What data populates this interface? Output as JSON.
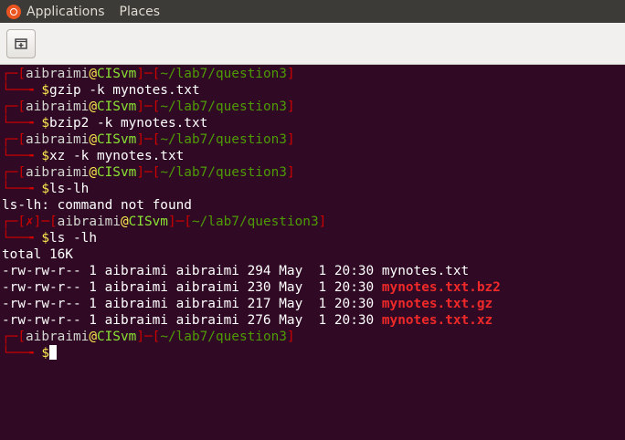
{
  "panel": {
    "menu": [
      "Applications",
      "Places"
    ]
  },
  "toolbar": {
    "new_tab_icon": "new-tab-icon"
  },
  "prompt": {
    "user": "aibraimi",
    "at": "@",
    "host": "CISvm",
    "path": "~/lab7/question3",
    "symbol": "$",
    "error_mark": "✗"
  },
  "commands": [
    "gzip -k mynotes.txt",
    "bzip2 -k mynotes.txt",
    "xz -k mynotes.txt",
    "ls-lh",
    "ls -lh"
  ],
  "error_output": "ls-lh: command not found",
  "ls_total": "total 16K",
  "ls_rows": [
    {
      "perms": "-rw-rw-r--",
      "links": "1",
      "owner": "aibraimi",
      "group": "aibraimi",
      "size": "294",
      "date": "May  1 20:30",
      "name": "mynotes.txt",
      "type": "plain"
    },
    {
      "perms": "-rw-rw-r--",
      "links": "1",
      "owner": "aibraimi",
      "group": "aibraimi",
      "size": "230",
      "date": "May  1 20:30",
      "name": "mynotes.txt.bz2",
      "type": "archive"
    },
    {
      "perms": "-rw-rw-r--",
      "links": "1",
      "owner": "aibraimi",
      "group": "aibraimi",
      "size": "217",
      "date": "May  1 20:30",
      "name": "mynotes.txt.gz",
      "type": "archive"
    },
    {
      "perms": "-rw-rw-r--",
      "links": "1",
      "owner": "aibraimi",
      "group": "aibraimi",
      "size": "276",
      "date": "May  1 20:30",
      "name": "mynotes.txt.xz",
      "type": "archive"
    }
  ]
}
